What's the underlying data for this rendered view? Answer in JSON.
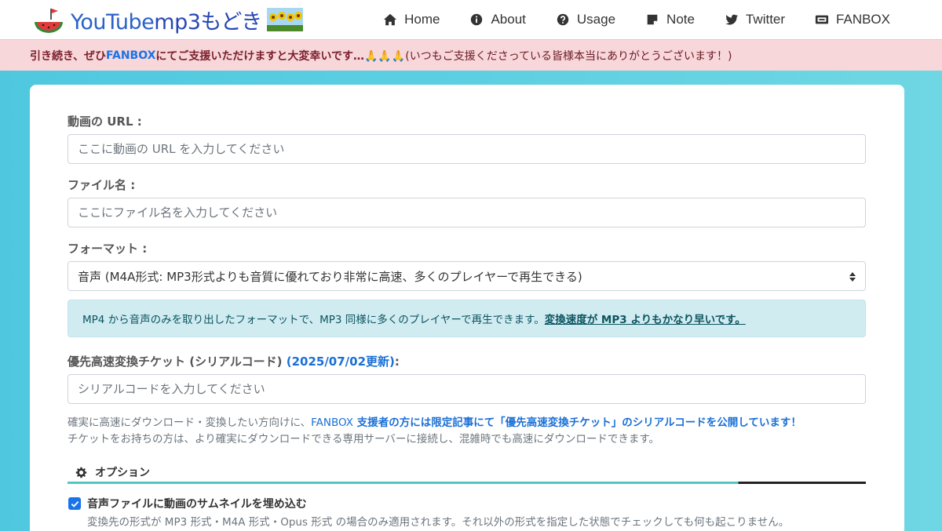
{
  "brand": {
    "text_youtube": "YouTube",
    "text_mp3": "mp3もどき"
  },
  "nav": [
    {
      "label": "Home",
      "icon": "home-icon"
    },
    {
      "label": "About",
      "icon": "info-icon"
    },
    {
      "label": "Usage",
      "icon": "question-icon"
    },
    {
      "label": "Note",
      "icon": "note-icon"
    },
    {
      "label": "Twitter",
      "icon": "twitter-icon"
    },
    {
      "label": "FANBOX",
      "icon": "fanbox-icon"
    }
  ],
  "alert": {
    "part1": "引き続き、ぜひ ",
    "link": "FANBOX",
    "part2": " にてご支援いただけますと大変幸いです…🙏🙏🙏",
    "part3": " (いつもご支援くださっている皆様本当にありがとうございます！)"
  },
  "form": {
    "url_label": "動画の URL :",
    "url_placeholder": "ここに動画の URL を入力してください",
    "filename_label": "ファイル名 :",
    "filename_placeholder": "ここにファイル名を入力してください",
    "format_label": "フォーマット :",
    "format_selected": "音声 (M4A形式: MP3形式よりも音質に優れており非常に高速、多くのプレイヤーで再生できる)",
    "info_text": "MP4 から音声のみを取り出したフォーマットで、MP3 同様に多くのプレイヤーで再生できます。",
    "info_link": "変換速度が MP3 よりもかなり早いです。",
    "ticket_label": "優先高速変換チケット (シリアルコード) ",
    "ticket_date": "(2025/07/02更新)",
    "ticket_colon": ":",
    "ticket_placeholder": "シリアルコードを入力してください",
    "help_line1_a": "確実に高速にダウンロード・変換したい方向けに、",
    "help_line1_link": "FANBOX",
    "help_line1_b": " 支援者の方には限定記事にて「優先高速変換チケット」のシリアルコードを公開しています！",
    "help_line2": "チケットをお持ちの方は、より確実にダウンロードできる専用サーバーに接続し、混雑時でも高速にダウンロードできます。",
    "options_title": "オプション",
    "thumbnail_label": "音声ファイルに動画のサムネイルを埋め込む",
    "thumbnail_checked": true,
    "thumbnail_note": "変換先の形式が MP3 形式・M4A 形式・Opus 形式 の場合のみ適用されます。それ以外の形式を指定した状態でチェックしても何も起こりません。"
  },
  "colors": {
    "accent": "#1a73e8",
    "brand": "#2a62c9",
    "alert_bg": "#f8d7da",
    "info_bg": "#d1ecf1"
  }
}
